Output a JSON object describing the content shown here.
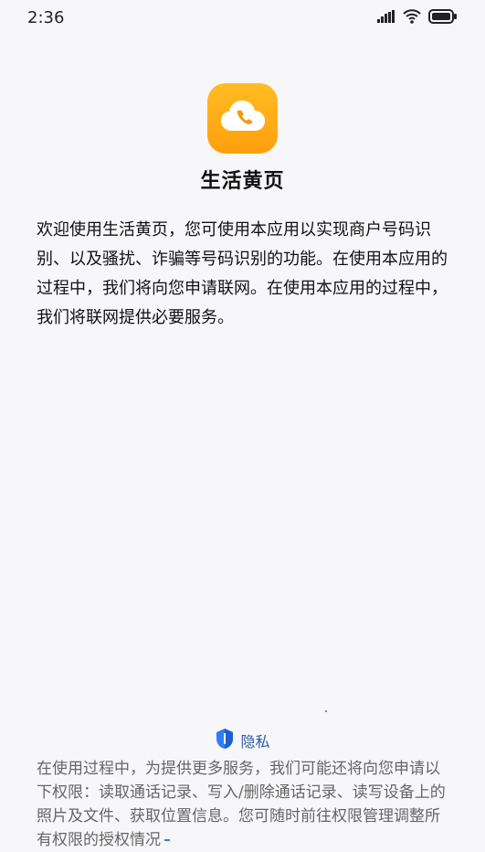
{
  "status_bar": {
    "time": "2:36",
    "icons": [
      "signal-icon",
      "wifi-icon",
      "battery-icon"
    ]
  },
  "app": {
    "name": "生活黄页",
    "icon": "phone-cloud-icon",
    "icon_colors": [
      "#ffbd23",
      "#ff9f0c"
    ]
  },
  "intro": {
    "text": "欢迎使用生活黄页，您可使用本应用以实现商户号码识别、以及骚扰、诈骗等号码识别的功能。在使用本应用的过程中，我们将向您申请联网。在使用本应用的过程中，我们将联网提供必要服务。"
  },
  "privacy": {
    "label": "隐私",
    "icon": "privacy-shield-icon",
    "accent": "#2e5ba3"
  },
  "permissions": {
    "text": "在使用过程中，为提供更多服务，我们可能还将向您申请以下权限：读取通话记录、写入/删除通话记录、读写设备上的照片及文件、获取位置信息。您可随时前往权限管理调整所有权限的授权情况"
  }
}
